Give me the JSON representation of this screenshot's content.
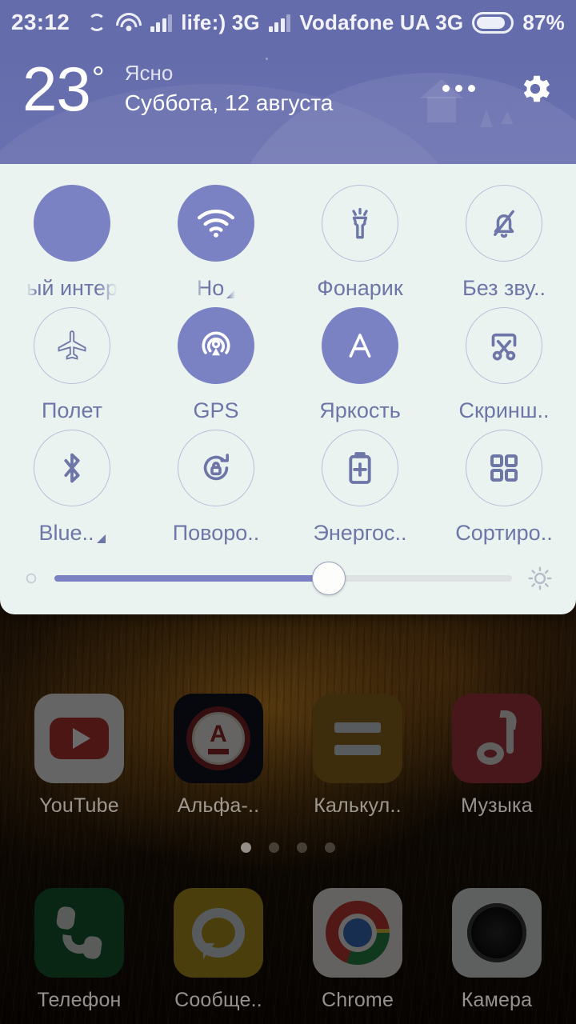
{
  "status_bar": {
    "clock": "23:12",
    "icons": [
      "sync-icon",
      "wifi-icon",
      "signal-bars-icon",
      "signal-bars-icon-2",
      "battery-icon"
    ],
    "carrier_1": "life:) 3G",
    "carrier_2": "Vodafone UA 3G",
    "battery_percent": "87%",
    "battery_level": 87,
    "background_color": "#646cab"
  },
  "quick_settings": {
    "weather": {
      "temperature": "23",
      "degree_symbol": "°",
      "condition": "Ясно",
      "date": "Суббота, 12 августа"
    },
    "header_actions": {
      "more": "more-options-icon",
      "settings": "gear-icon"
    },
    "toggles": [
      {
        "id": "mobile-data",
        "label": "ый интер",
        "icon": "data-transfer-icon",
        "state": "on",
        "marquee": true,
        "caret": false
      },
      {
        "id": "wifi",
        "label": "Но",
        "icon": "wifi-icon",
        "state": "on",
        "marquee": true,
        "caret": true
      },
      {
        "id": "flashlight",
        "label": "Фонарик",
        "icon": "flashlight-icon",
        "state": "off",
        "marquee": false,
        "caret": false
      },
      {
        "id": "silent",
        "label": "Без зву..",
        "icon": "bell-muted-icon",
        "state": "off",
        "marquee": false,
        "caret": false
      },
      {
        "id": "airplane",
        "label": "Полет",
        "icon": "airplane-icon",
        "state": "off",
        "marquee": false,
        "caret": false
      },
      {
        "id": "gps",
        "label": "GPS",
        "icon": "gps-beacon-icon",
        "state": "on",
        "marquee": false,
        "caret": false
      },
      {
        "id": "brightness-auto",
        "label": "Яркость",
        "icon": "auto-brightness-icon",
        "state": "on",
        "marquee": false,
        "caret": false
      },
      {
        "id": "screenshot",
        "label": "Скринш..",
        "icon": "scissors-icon",
        "state": "off",
        "marquee": false,
        "caret": false
      },
      {
        "id": "bluetooth",
        "label": "Blue..",
        "icon": "bluetooth-icon",
        "state": "off",
        "marquee": false,
        "caret": true
      },
      {
        "id": "rotation",
        "label": "Поворо..",
        "icon": "rotation-lock-icon",
        "state": "off",
        "marquee": false,
        "caret": false
      },
      {
        "id": "battery-saver",
        "label": "Энергос..",
        "icon": "battery-plus-icon",
        "state": "off",
        "marquee": false,
        "caret": false
      },
      {
        "id": "sort",
        "label": "Сортиро..",
        "icon": "grid-sort-icon",
        "state": "off",
        "marquee": false,
        "caret": false
      }
    ],
    "brightness_slider": {
      "value_percent": 60,
      "low_icon": "brightness-low-icon",
      "high_icon": "brightness-high-icon"
    },
    "accent_color": "#7b82c4",
    "panel_background": "#eaf3f0",
    "label_color": "#6e76a8"
  },
  "home_screen": {
    "page_dots": {
      "count": 4,
      "active_index": 0
    },
    "apps": [
      {
        "label": "YouTube",
        "icon": "youtube-icon"
      },
      {
        "label": "Альфа-..",
        "icon": "alfabank-icon"
      },
      {
        "label": "Калькул..",
        "icon": "calculator-icon"
      },
      {
        "label": "Музыка",
        "icon": "music-icon"
      }
    ],
    "dock": [
      {
        "label": "Телефон",
        "icon": "phone-icon"
      },
      {
        "label": "Сообще..",
        "icon": "messages-icon"
      },
      {
        "label": "Chrome",
        "icon": "chrome-icon"
      },
      {
        "label": "Камера",
        "icon": "camera-icon"
      }
    ]
  }
}
